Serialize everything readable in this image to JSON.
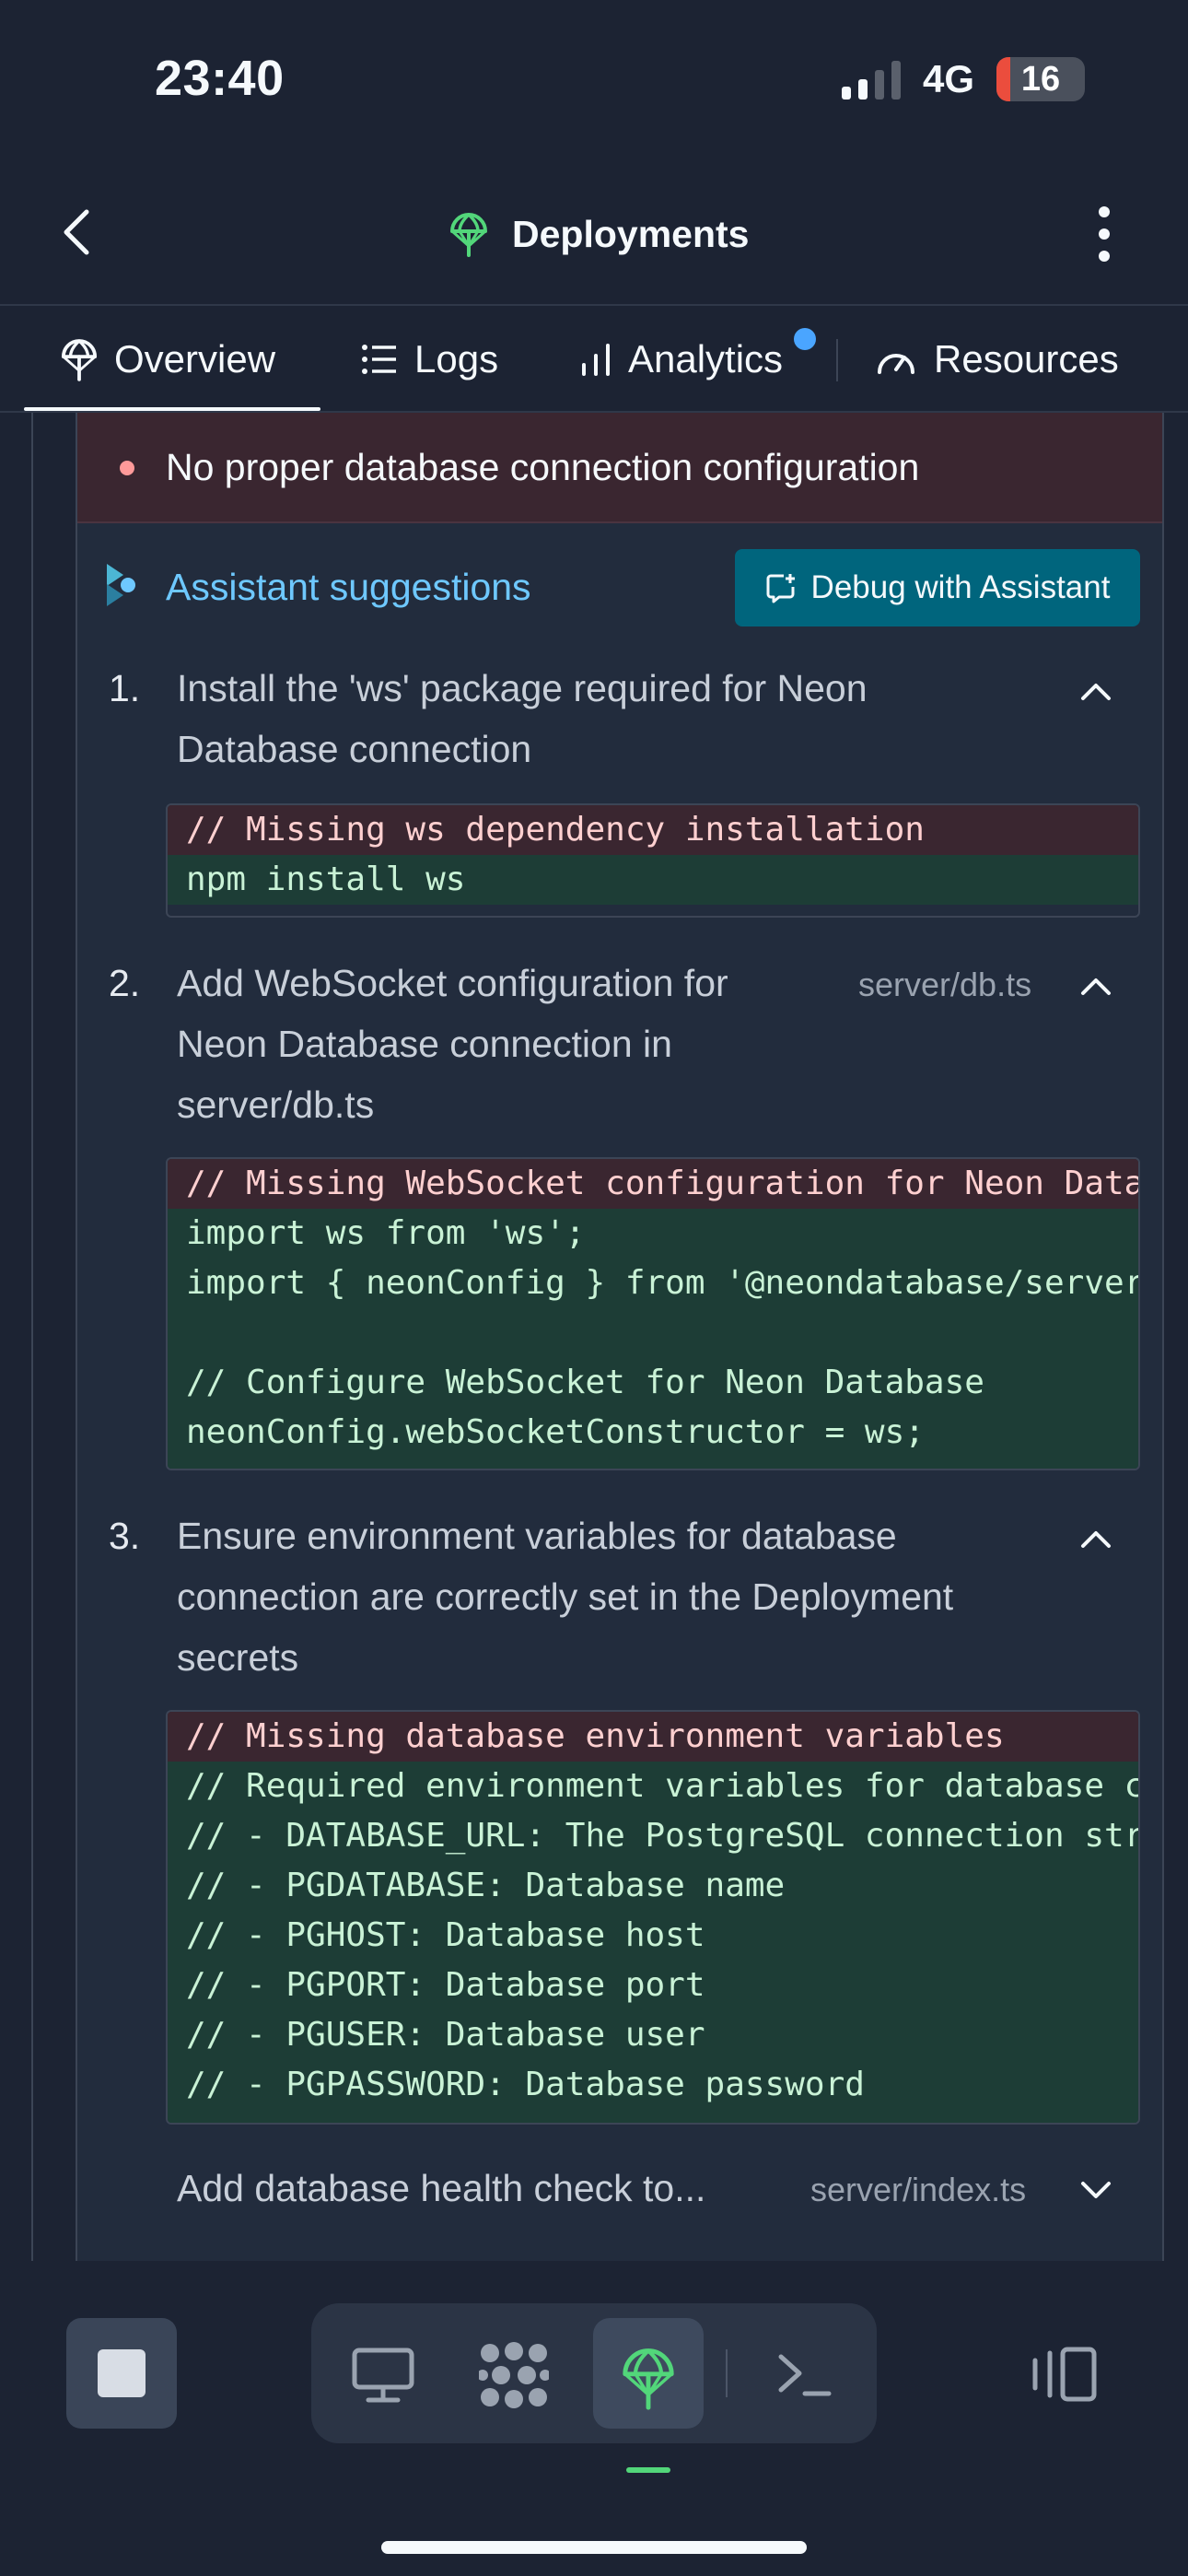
{
  "status_bar": {
    "time": "23:40",
    "network": "4G",
    "battery": "16",
    "battery_level": 0.16
  },
  "header": {
    "title": "Deployments"
  },
  "tabs": [
    {
      "label": "Overview",
      "icon": "deployments-icon",
      "active": true
    },
    {
      "label": "Logs",
      "icon": "list-icon"
    },
    {
      "label": "Analytics",
      "icon": "bar-chart-icon",
      "has_notification": true
    },
    {
      "label": "Resources",
      "icon": "gauge-icon"
    }
  ],
  "error": {
    "text": "No proper database connection configuration"
  },
  "assistant": {
    "label": "Assistant suggestions",
    "debug_button": "Debug with Assistant"
  },
  "suggestions": [
    {
      "number": "1.",
      "title_lines": [
        "Install the 'ws' package required for Neon",
        "Database connection"
      ],
      "file": "",
      "expanded": true,
      "code": [
        {
          "type": "del",
          "text": "// Missing ws dependency installation"
        },
        {
          "type": "add",
          "text": "npm install ws"
        }
      ]
    },
    {
      "number": "2.",
      "title_lines": [
        "Add WebSocket configuration for",
        "Neon Database connection in",
        "server/db.ts"
      ],
      "file": "server/db.ts",
      "expanded": true,
      "code": [
        {
          "type": "del",
          "text": "// Missing WebSocket configuration for Neon Database"
        },
        {
          "type": "add",
          "text": "import ws from 'ws';"
        },
        {
          "type": "add",
          "text": "import { neonConfig } from '@neondatabase/serverless';"
        },
        {
          "type": "add",
          "text": ""
        },
        {
          "type": "add",
          "text": "// Configure WebSocket for Neon Database"
        },
        {
          "type": "add",
          "text": "neonConfig.webSocketConstructor = ws;"
        }
      ]
    },
    {
      "number": "3.",
      "title_lines": [
        "Ensure environment variables for database",
        "connection are correctly set in the Deployment",
        "secrets"
      ],
      "file": "",
      "expanded": true,
      "code": [
        {
          "type": "del",
          "text": "// Missing database environment variables"
        },
        {
          "type": "add",
          "text": "// Required environment variables for database connection:"
        },
        {
          "type": "add",
          "text": "// - DATABASE_URL: The PostgreSQL connection string"
        },
        {
          "type": "add",
          "text": "// - PGDATABASE: Database name"
        },
        {
          "type": "add",
          "text": "// - PGHOST: Database host"
        },
        {
          "type": "add",
          "text": "// - PGPORT: Database port"
        },
        {
          "type": "add",
          "text": "// - PGUSER: Database user"
        },
        {
          "type": "add",
          "text": "// - PGPASSWORD: Database password"
        }
      ]
    },
    {
      "number": "",
      "title_lines": [
        "Add database health check to..."
      ],
      "file": "server/index.ts",
      "expanded": false,
      "code": []
    }
  ],
  "bottom_bar": {
    "buttons": [
      "stop-icon",
      "desktop-icon",
      "workspace-icon",
      "deployments-icon",
      "terminal-icon",
      "panels-icon"
    ],
    "active": "deployments-icon"
  },
  "colors": {
    "accent_green": "#52d67a",
    "accent_blue": "#6ec8ff",
    "button_teal": "#00657d",
    "error_bg": "#3a2630",
    "added_bg": "#1d3d36"
  }
}
